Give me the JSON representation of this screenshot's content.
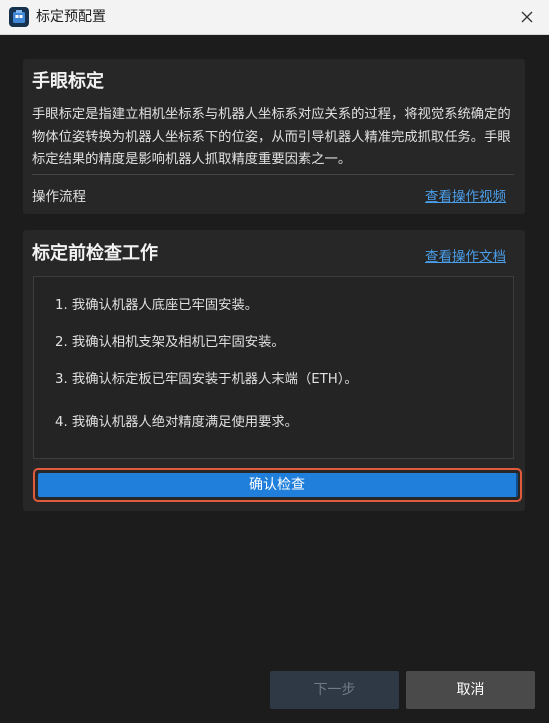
{
  "window": {
    "title": "标定预配置",
    "close_icon": "close-icon",
    "app_icon": "app-logo-icon"
  },
  "hand_eye": {
    "title": "手眼标定",
    "description": "手眼标定是指建立相机坐标系与机器人坐标系对应关系的过程，将视觉系统确定的物体位姿转换为机器人坐标系下的位姿，从而引导机器人精准完成抓取任务。手眼标定结果的精度是影响机器人抓取精度重要因素之一。",
    "flow_label": "操作流程",
    "video_link": "查看操作视频"
  },
  "precheck": {
    "title": "标定前检查工作",
    "doc_link": "查看操作文档",
    "items": [
      "1. 我确认机器人底座已牢固安装。",
      "2. 我确认相机支架及相机已牢固安装。",
      "3. 我确认标定板已牢固安装于机器人末端（ETH）。",
      "4. 我确认机器人绝对精度满足使用要求。"
    ],
    "confirm_label": "确认检查"
  },
  "footer": {
    "next_label": "下一步",
    "cancel_label": "取消"
  },
  "colors": {
    "accent": "#1f7fdb",
    "link": "#4a9de8",
    "highlight_border": "#e05a3e"
  }
}
